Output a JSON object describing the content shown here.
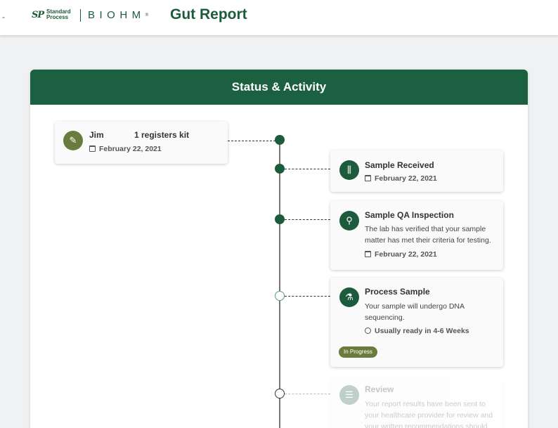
{
  "header": {
    "dash": "-",
    "logo_sp_mark": "SP",
    "logo_sp_line1": "Standard",
    "logo_sp_line2": "Process",
    "logo_biohm": "BIOHM",
    "logo_tm": "®",
    "title": "Gut Report"
  },
  "card": {
    "title": "Status & Activity"
  },
  "events": [
    {
      "user": "Jim",
      "action": "1 registers kit",
      "date": "February 22, 2021",
      "icon": "pencil-icon"
    },
    {
      "title": "Sample Received",
      "date": "February 22, 2021",
      "icon": "test-tubes-icon"
    },
    {
      "title": "Sample QA Inspection",
      "description": "The lab has verified that your sample matter has met their criteria for testing.",
      "date": "February 22, 2021",
      "icon": "magnifier-icon"
    },
    {
      "title": "Process Sample",
      "description": "Your sample will undergo DNA sequencing.",
      "eta": "Usually ready in 4-6  Weeks",
      "status": "In Progress",
      "icon": "flask-icon"
    },
    {
      "title": "Review",
      "description": "Your report results have been sent to your healthcare provider for review and your written recommendations should",
      "icon": "document-search-icon"
    }
  ],
  "colors": {
    "brand_green": "#1c5b3c",
    "olive": "#6a7c3c"
  }
}
